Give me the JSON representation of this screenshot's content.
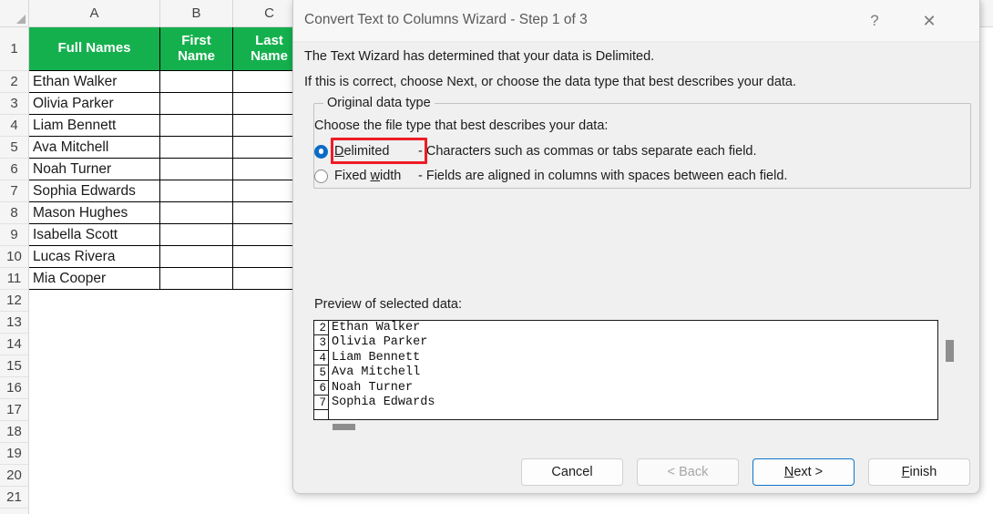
{
  "spreadsheet": {
    "column_headers": [
      "A",
      "B",
      "C"
    ],
    "row_numbers": [
      "1",
      "2",
      "3",
      "4",
      "5",
      "6",
      "7",
      "8",
      "9",
      "10",
      "11",
      "12",
      "13",
      "14",
      "15",
      "16",
      "17",
      "18",
      "19",
      "20",
      "21"
    ],
    "header_fill": "#15b04e",
    "header_text_color": "#ffffff",
    "table_headers": [
      "Full Names",
      "First\nName",
      "Last\nName"
    ],
    "header_a": "Full Names",
    "header_b_line1": "First",
    "header_b_line2": "Name",
    "header_c_line1": "Last",
    "header_c_line2": "Name",
    "rows": [
      {
        "full_name": "Ethan Walker",
        "first": "",
        "last": ""
      },
      {
        "full_name": "Olivia Parker",
        "first": "",
        "last": ""
      },
      {
        "full_name": "Liam Bennett",
        "first": "",
        "last": ""
      },
      {
        "full_name": "Ava Mitchell",
        "first": "",
        "last": ""
      },
      {
        "full_name": "Noah Turner",
        "first": "",
        "last": ""
      },
      {
        "full_name": "Sophia Edwards",
        "first": "",
        "last": ""
      },
      {
        "full_name": "Mason Hughes",
        "first": "",
        "last": ""
      },
      {
        "full_name": "Isabella Scott",
        "first": "",
        "last": ""
      },
      {
        "full_name": "Lucas Rivera",
        "first": "",
        "last": ""
      },
      {
        "full_name": "Mia Cooper",
        "first": "",
        "last": ""
      }
    ]
  },
  "dialog": {
    "title": "Convert Text to Columns Wizard - Step 1 of 3",
    "help_icon": "?",
    "close_icon": "✕",
    "line1": "The Text Wizard has determined that your data is Delimited.",
    "line2": "If this is correct, choose Next, or choose the data type that best describes your data.",
    "group": {
      "label": "Original data type",
      "choose_label": "Choose the file type that best describes your data:",
      "options": [
        {
          "accel": "D",
          "label_rest": "elimited",
          "full_label": "Delimited",
          "description": "- Characters such as commas or tabs separate each field.",
          "selected": true
        },
        {
          "pre": "Fixed ",
          "accel": "w",
          "label_rest": "idth",
          "full_label": "Fixed width",
          "description": "- Fields are aligned in columns with spaces between each field.",
          "selected": false
        }
      ]
    },
    "preview": {
      "label": "Preview of selected data:",
      "rows": [
        {
          "num": "2",
          "text": "Ethan Walker"
        },
        {
          "num": "3",
          "text": "Olivia Parker"
        },
        {
          "num": "4",
          "text": "Liam Bennett"
        },
        {
          "num": "5",
          "text": "Ava Mitchell"
        },
        {
          "num": "6",
          "text": "Noah Turner"
        },
        {
          "num": "7",
          "text": "Sophia Edwards"
        }
      ]
    },
    "buttons": {
      "cancel": "Cancel",
      "back": "< Back",
      "next_accel": "N",
      "next_rest": "ext >",
      "next_full": "Next >",
      "finish_accel": "F",
      "finish_rest": "inish",
      "finish_full": "Finish"
    },
    "highlight_color": "#ee1c25",
    "focus_color": "#1273c9"
  }
}
